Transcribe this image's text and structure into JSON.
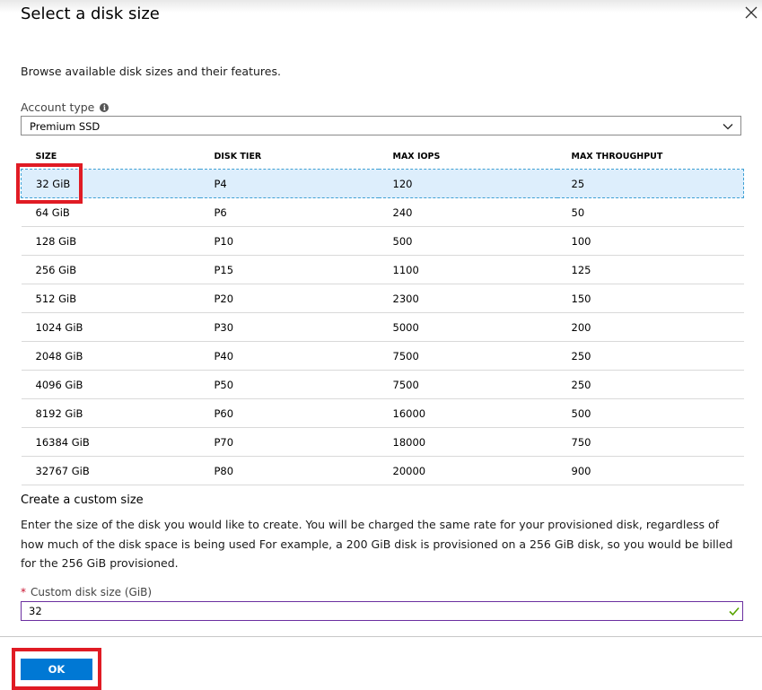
{
  "dialog": {
    "title": "Select a disk size",
    "close_icon": "close-icon",
    "description": "Browse available disk sizes and their features."
  },
  "account_type": {
    "label": "Account type",
    "info_icon": "info-icon",
    "value": "Premium SSD"
  },
  "table": {
    "headers": [
      "SIZE",
      "DISK TIER",
      "MAX IOPS",
      "MAX THROUGHPUT"
    ],
    "rows": [
      [
        "32 GiB",
        "P4",
        "120",
        "25"
      ],
      [
        "64 GiB",
        "P6",
        "240",
        "50"
      ],
      [
        "128 GiB",
        "P10",
        "500",
        "100"
      ],
      [
        "256 GiB",
        "P15",
        "1100",
        "125"
      ],
      [
        "512 GiB",
        "P20",
        "2300",
        "150"
      ],
      [
        "1024 GiB",
        "P30",
        "5000",
        "200"
      ],
      [
        "2048 GiB",
        "P40",
        "7500",
        "250"
      ],
      [
        "4096 GiB",
        "P50",
        "7500",
        "250"
      ],
      [
        "8192 GiB",
        "P60",
        "16000",
        "500"
      ],
      [
        "16384 GiB",
        "P70",
        "18000",
        "750"
      ],
      [
        "32767 GiB",
        "P80",
        "20000",
        "900"
      ]
    ],
    "selected_index": 0
  },
  "custom": {
    "title": "Create a custom size",
    "description": "Enter the size of the disk you would like to create. You will be charged the same rate for your provisioned disk, regardless of how much of the disk space is being used For example, a 200 GiB disk is provisioned on a 256 GiB disk, so you would be billed for the 256 GiB provisioned.",
    "field_required_mark": "*",
    "field_label": "Custom disk size (GiB)",
    "field_value": "32",
    "valid_icon": "checkmark-icon"
  },
  "footer": {
    "ok_label": "OK"
  },
  "colors": {
    "accent": "#0078d4",
    "selected_row": "#ddeefc",
    "highlight_box": "#e01b24",
    "valid_check": "#57a300"
  }
}
